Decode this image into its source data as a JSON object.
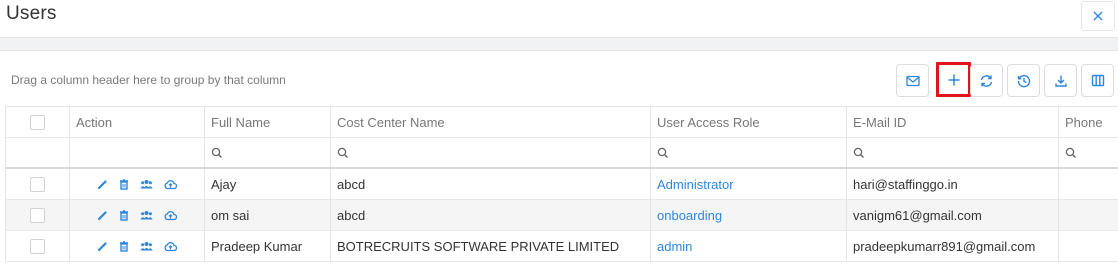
{
  "dialog": {
    "title": "Users"
  },
  "toolbar": {
    "group_hint": "Drag a column header here to group by that column"
  },
  "grid": {
    "columns": [
      "",
      "Action",
      "Full Name",
      "Cost Center Name",
      "User Access Role",
      "E-Mail ID",
      "Phone"
    ],
    "rows": [
      {
        "full_name": "Ajay",
        "cost_center": "abcd",
        "role": "Administrator",
        "email": "hari@staffinggo.in",
        "phone": ""
      },
      {
        "full_name": "om sai",
        "cost_center": "abcd",
        "role": "onboarding",
        "email": "vanigm61@gmail.com",
        "phone": ""
      },
      {
        "full_name": "Pradeep Kumar",
        "cost_center": "BOTRECRUITS SOFTWARE PRIVATE LIMITED",
        "role": "admin",
        "email": "pradeepkumarr891@gmail.com",
        "phone": ""
      }
    ]
  },
  "colors": {
    "accent": "#2e86de",
    "highlight": "#e0141a"
  }
}
